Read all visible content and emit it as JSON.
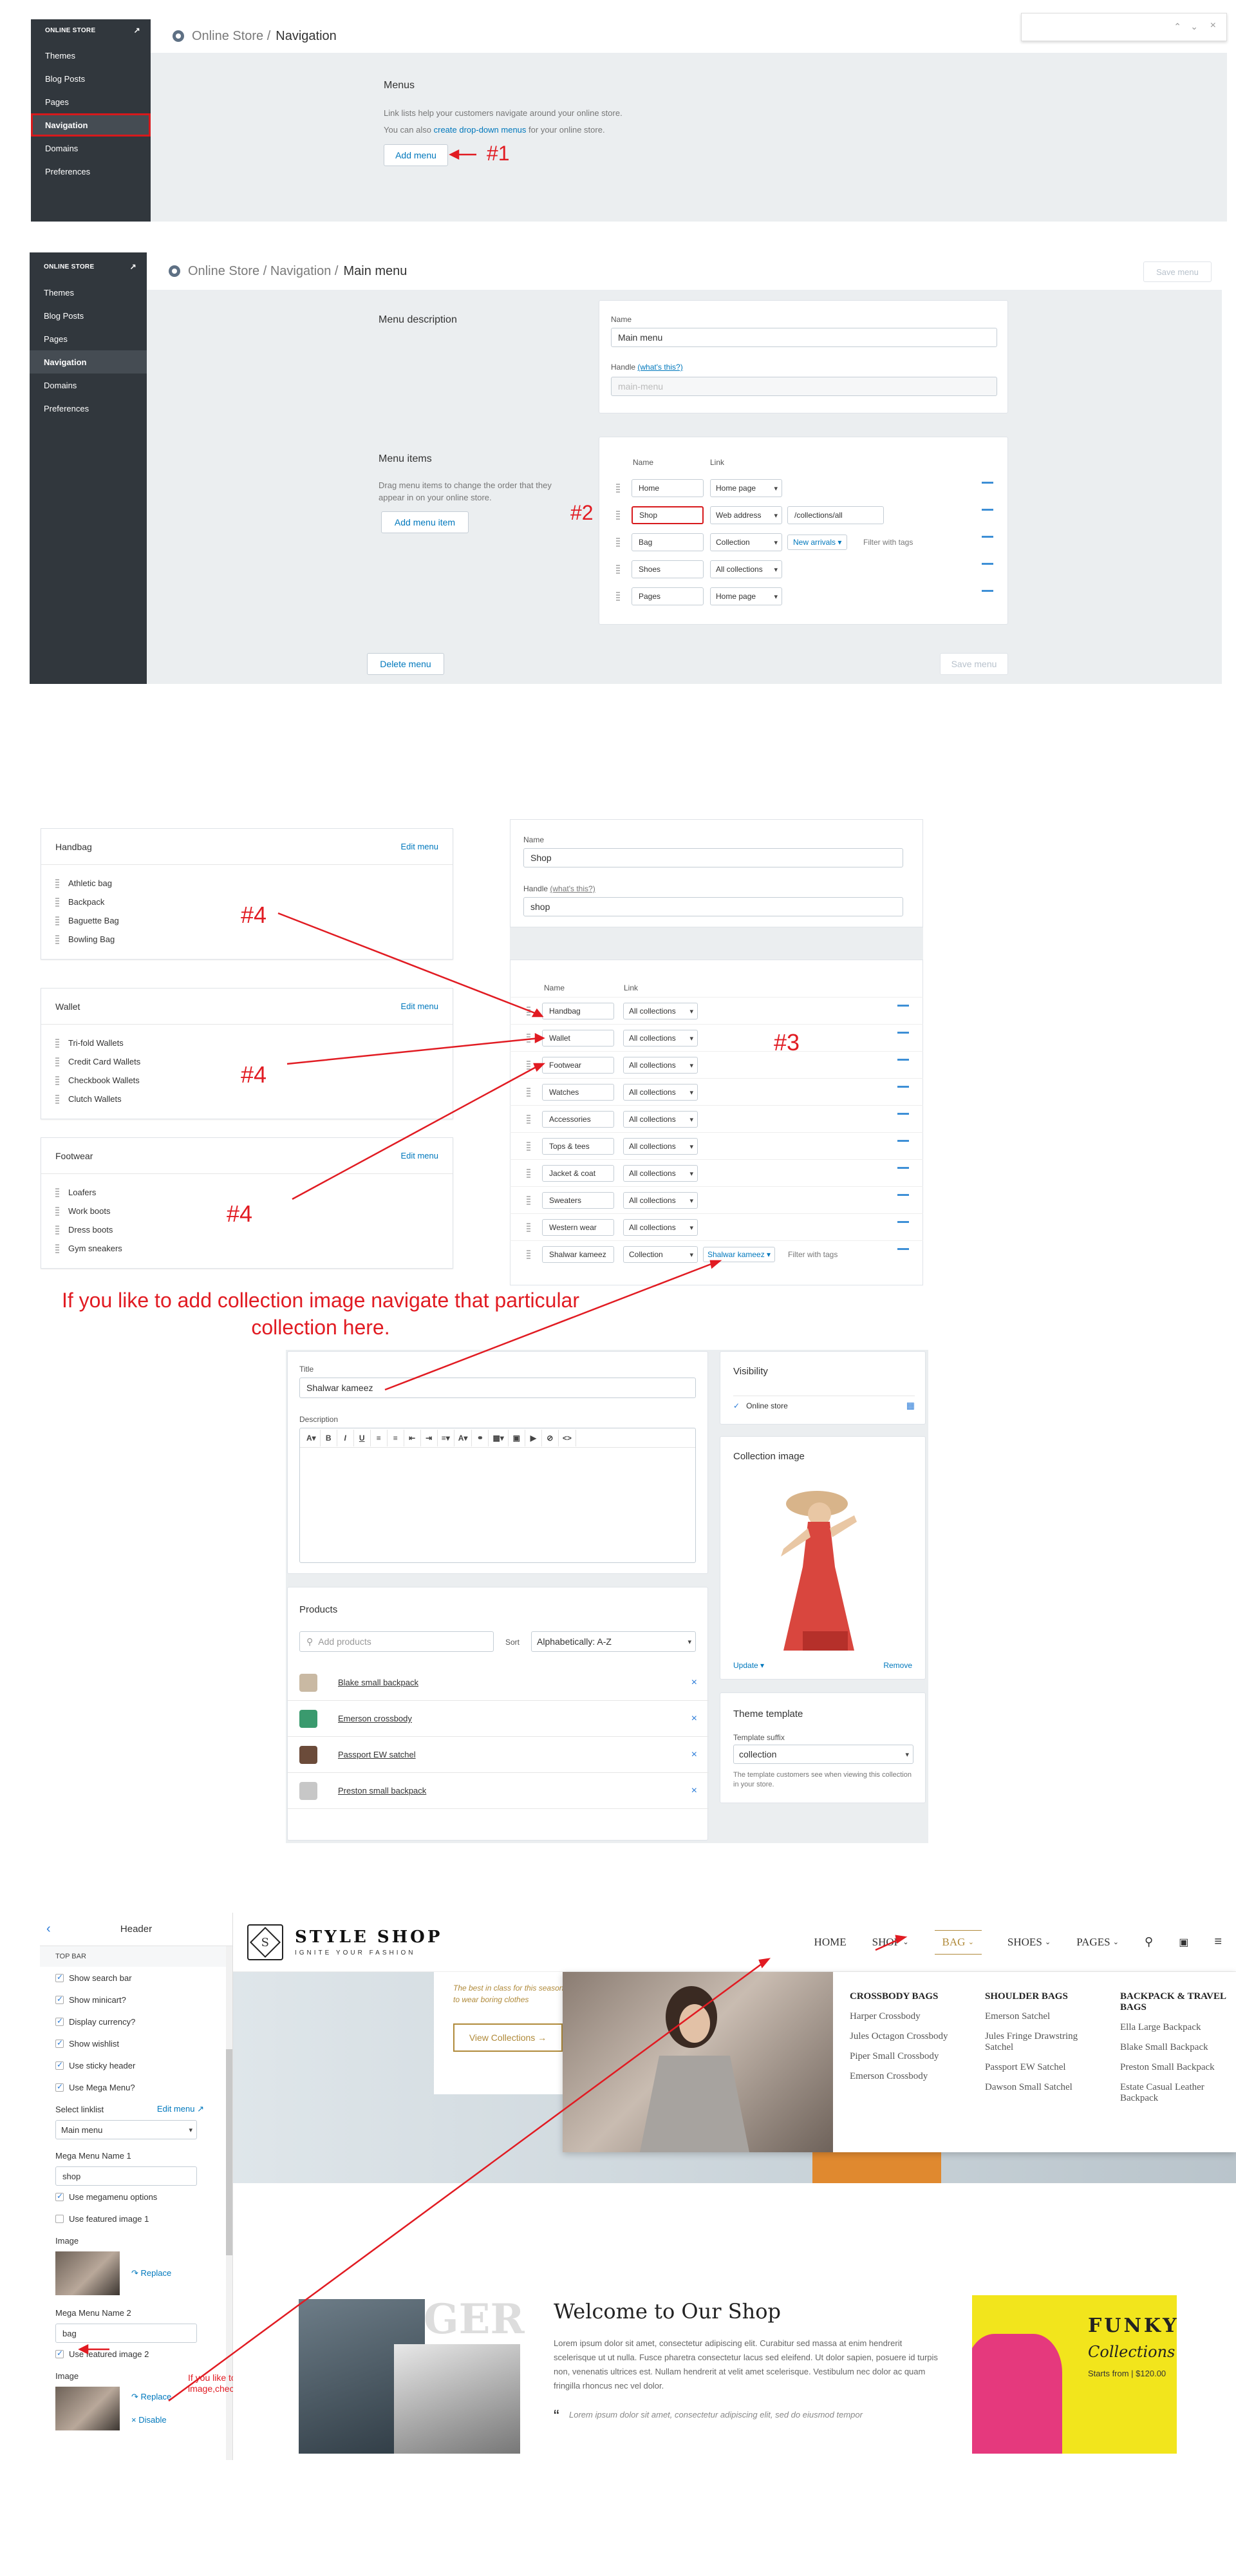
{
  "admin": {
    "sidebar_title": "ONLINE STORE",
    "sidebar_items": [
      "Themes",
      "Blog Posts",
      "Pages",
      "Navigation",
      "Domains",
      "Preferences"
    ]
  },
  "panel1": {
    "breadcrumb_parent": "Online Store /",
    "breadcrumb_current": "Navigation",
    "menus_heading": "Menus",
    "menus_desc": "Link lists help your customers navigate around your online store.",
    "menus_desc2_pre": "You can also",
    "menus_desc2_link": "create drop-down menus",
    "menus_desc2_post": "for your online store.",
    "add_menu": "Add menu",
    "annotation": "#1"
  },
  "panel2": {
    "breadcrumb_parent": "Online Store / Navigation /",
    "breadcrumb_current": "Main menu",
    "save": "Save menu",
    "desc_title": "Menu description",
    "name_label": "Name",
    "name_value": "Main menu",
    "handle_label": "Handle",
    "handle_hint": "(what's this?)",
    "handle_value": "main-menu",
    "items_title": "Menu items",
    "items_desc": "Drag menu items to change the order that they appear in on your online store.",
    "add_item": "Add menu item",
    "col_name": "Name",
    "col_link": "Link",
    "rows": [
      {
        "name": "Home",
        "link": "Home page",
        "extra": "",
        "sub": ""
      },
      {
        "name": "Shop",
        "link": "Web address",
        "extra": "/collections/all",
        "sub": ""
      },
      {
        "name": "Bag",
        "link": "Collection",
        "extra": "New arrivals",
        "sub": "Filter with tags"
      },
      {
        "name": "Shoes",
        "link": "All collections",
        "extra": "",
        "sub": ""
      },
      {
        "name": "Pages",
        "link": "Home page",
        "extra": "",
        "sub": ""
      }
    ],
    "delete": "Delete menu",
    "annotation": "#2"
  },
  "panel3": {
    "cards": [
      {
        "title": "Handbag",
        "edit": "Edit menu",
        "items": [
          "Athletic bag",
          "Backpack",
          "Baguette Bag",
          "Bowling Bag"
        ]
      },
      {
        "title": "Wallet",
        "edit": "Edit menu",
        "items": [
          "Tri-fold Wallets",
          "Credit Card Wallets",
          "Checkbook Wallets",
          "Clutch Wallets"
        ]
      },
      {
        "title": "Footwear",
        "edit": "Edit menu",
        "items": [
          "Loafers",
          "Work boots",
          "Dress boots",
          "Gym sneakers"
        ]
      }
    ],
    "name_label": "Name",
    "name_value": "Shop",
    "handle_label": "Handle",
    "handle_hint": "(what's this?)",
    "handle_value": "shop",
    "col_name": "Name",
    "col_link": "Link",
    "rows": [
      {
        "name": "Handbag",
        "link": "All collections"
      },
      {
        "name": "Wallet",
        "link": "All collections"
      },
      {
        "name": "Footwear",
        "link": "All collections"
      },
      {
        "name": "Watches",
        "link": "All collections"
      },
      {
        "name": "Accessories",
        "link": "All collections"
      },
      {
        "name": "Tops & tees",
        "link": "All collections"
      },
      {
        "name": "Jacket & coat",
        "link": "All collections"
      },
      {
        "name": "Sweaters",
        "link": "All collections"
      },
      {
        "name": "Western wear",
        "link": "All collections"
      },
      {
        "name": "Shalwar kameez",
        "link": "Collection"
      }
    ],
    "last_extra": "Shalwar kameez",
    "last_filter": "Filter with tags",
    "anno4": "#4",
    "anno3": "#3",
    "note": "If you like to add collection image navigate that particular collection here."
  },
  "panel4": {
    "title_label": "Title",
    "title_value": "Shalwar kameez",
    "desc_label": "Description",
    "products_title": "Products",
    "search_placeholder": "Add products",
    "sort_label": "Sort",
    "sort_value": "Alphabetically: A-Z",
    "products": [
      "Blake small backpack",
      "Emerson crossbody",
      "Passport EW satchel",
      "Preston small backpack"
    ],
    "visibility_title": "Visibility",
    "visibility_value": "Online store",
    "image_title": "Collection image",
    "update": "Update",
    "remove": "Remove",
    "template_title": "Theme template",
    "template_label": "Template suffix",
    "template_value": "collection",
    "template_help": "The template customers see when viewing this collection in your store."
  },
  "panel5": {
    "header_title": "Header",
    "section": "TOP BAR",
    "checks": [
      {
        "label": "Show search bar",
        "on": true
      },
      {
        "label": "Show minicart?",
        "on": true
      },
      {
        "label": "Display currency?",
        "on": true
      },
      {
        "label": "Show wishlist",
        "on": true
      },
      {
        "label": "Use sticky header",
        "on": true
      },
      {
        "label": "Use Mega Menu?",
        "on": true
      }
    ],
    "linklist_label": "Select linklist",
    "linklist_edit": "Edit menu",
    "linklist_value": "Main menu",
    "mm1_label": "Mega Menu Name 1",
    "mm1_value": "shop",
    "mm1_opts": [
      {
        "label": "Use megamenu options",
        "on": true
      },
      {
        "label": "Use featured image 1",
        "on": false
      }
    ],
    "image_label": "Image",
    "replace": "Replace",
    "disable": "Disable",
    "mm2_label": "Mega Menu Name 2",
    "mm2_value": "bag",
    "mm2_opt": "Use featured image 2",
    "note": "If you like to add featured image,check this option.",
    "store": {
      "brand": "STYLE SHOP",
      "tagline": "IGNITE YOUR FASHION",
      "nav": [
        "HOME",
        "SHOP",
        "BAG",
        "SHOES",
        "PAGES"
      ],
      "hero_text": "The best in class for this season to wear boring clothes",
      "hero_btn": "View Collections",
      "mega_cols": [
        {
          "title": "CROSSBODY BAGS",
          "items": [
            "Harper Crossbody",
            "Jules Octagon Crossbody",
            "Piper Small Crossbody",
            "Emerson Crossbody"
          ]
        },
        {
          "title": "SHOULDER BAGS",
          "items": [
            "Emerson Satchel",
            "Jules Fringe Drawstring Satchel",
            "Passport EW Satchel",
            "Dawson Small Satchel"
          ]
        },
        {
          "title": "BACKPACK & TRAVEL BAGS",
          "items": [
            "Ella Large Backpack",
            "Blake Small Backpack",
            "Preston Small Backpack",
            "Estate Casual Leather Backpack"
          ]
        }
      ],
      "welcome_title": "Welcome to Our Shop",
      "welcome_body": "Lorem ipsum dolor sit amet, consectetur adipiscing elit. Curabitur sed massa at enim hendrerit scelerisque ut ut nulla. Fusce pharetra consectetur lacus sed eleifend. Ut dolor sapien, posuere id turpis non, venenatis ultrices est. Nullam hendrerit at velit amet scelerisque. Vestibulum nec dolor ac quam fringilla rhoncus nec vel dolor.",
      "quote": "Lorem ipsum dolor sit amet, consectetur adipiscing elit, sed do eiusmod tempor",
      "overlay_word": "GER",
      "promo_title": "FUNKY",
      "promo_sub": "Collections",
      "promo_price": "Starts from | $120.00"
    }
  }
}
